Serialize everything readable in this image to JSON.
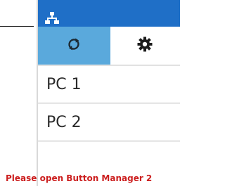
{
  "app": {
    "title_icon": "network-icon"
  },
  "toolbar": {
    "refresh_icon": "refresh-icon",
    "settings_icon": "gear-icon",
    "accent_color": "#5aa9dc",
    "title_bar_color": "#1f6fc7"
  },
  "devices": [
    {
      "label": "PC 1"
    },
    {
      "label": "PC 2"
    }
  ],
  "status": {
    "message": "Please open Button Manager 2"
  },
  "colors": {
    "message": "#cc1f1f"
  }
}
